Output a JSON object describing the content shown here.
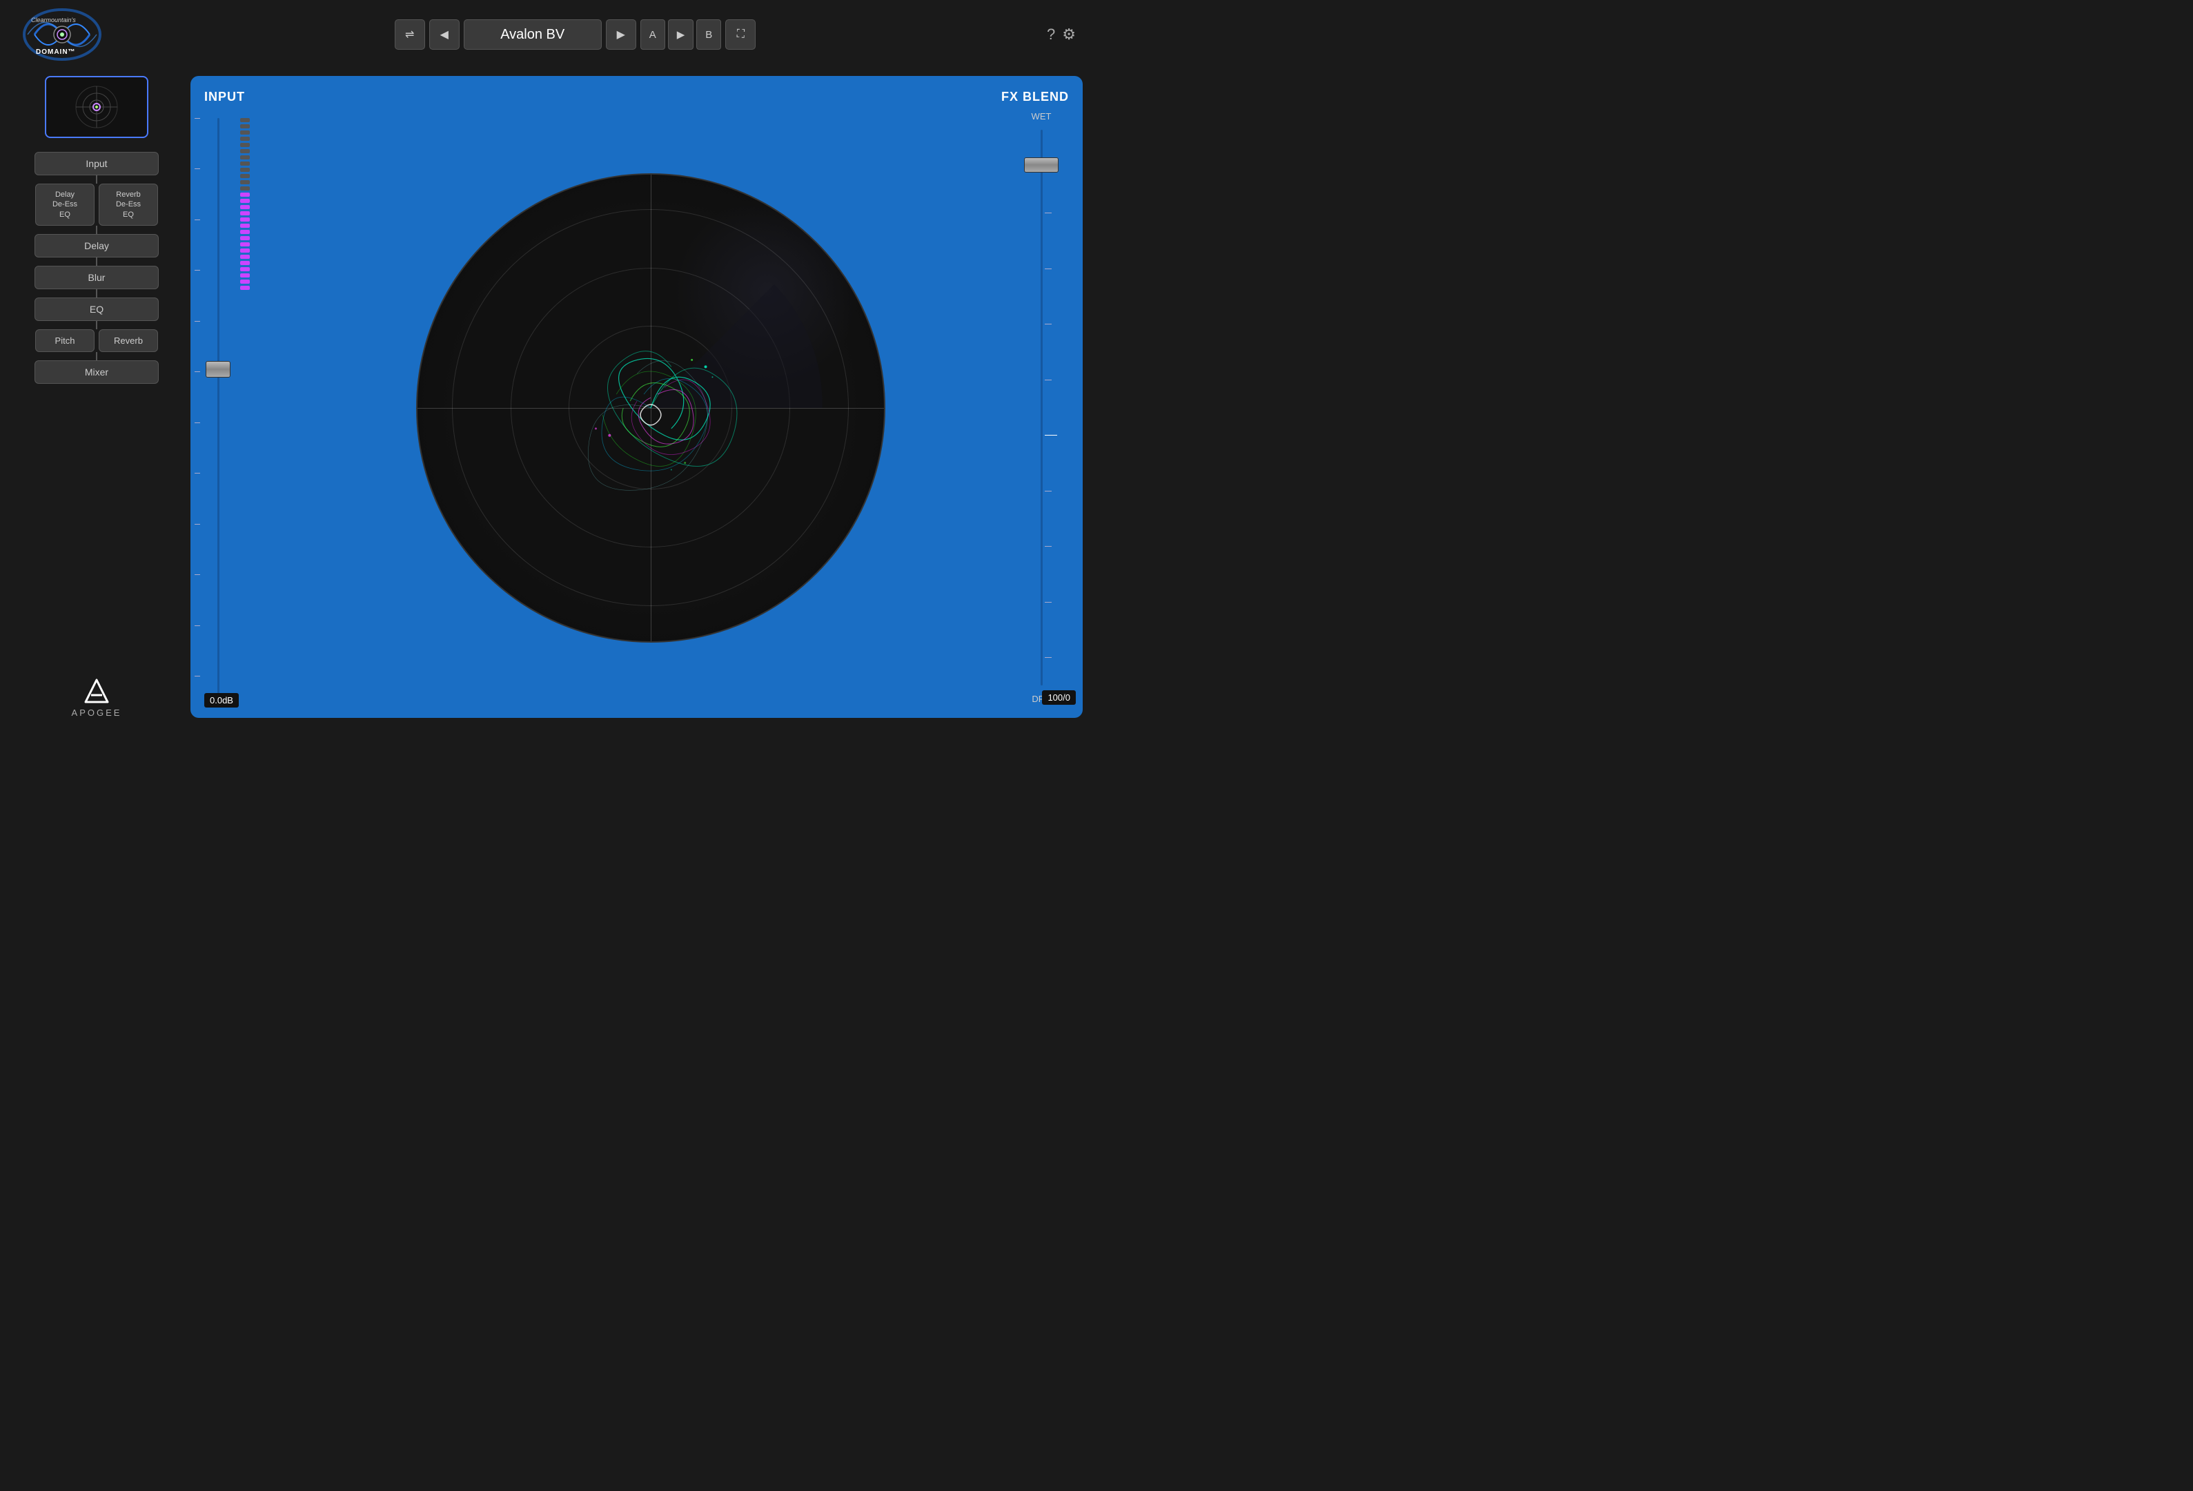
{
  "app": {
    "title": "Clearmountain's DOMAIN",
    "logo_text": "Clearmountain's\nDOMAIN"
  },
  "topbar": {
    "shuffle_label": "⇌",
    "prev_label": "◀",
    "preset_name": "Avalon BV",
    "next_label": "▶",
    "a_label": "A",
    "play_label": "▶",
    "b_label": "B",
    "fullscreen_label": "⛶",
    "help_label": "?",
    "settings_label": "⚙"
  },
  "sidebar": {
    "visualizer_label": "visualizer",
    "chain": [
      {
        "label": "Input",
        "type": "full"
      },
      {
        "label": "Delay De-Ess EQ",
        "type": "half"
      },
      {
        "label": "Reverb De-Ess EQ",
        "type": "half"
      },
      {
        "label": "Delay",
        "type": "full"
      },
      {
        "label": "Blur",
        "type": "full"
      },
      {
        "label": "EQ",
        "type": "full"
      },
      {
        "label": "Pitch",
        "type": "half"
      },
      {
        "label": "Reverb",
        "type": "half"
      },
      {
        "label": "Mixer",
        "type": "full"
      }
    ],
    "apogee_label": "APOGEE"
  },
  "input_panel": {
    "label": "INPUT",
    "fader_value": "0.0dB",
    "fader_position_pct": 42,
    "meter_dots": 28,
    "meter_active_count": 16
  },
  "fx_blend": {
    "label": "FX BLEND",
    "wet_label": "WET",
    "dry_label": "DRY",
    "value": "100/0",
    "fader_position_pct": 8,
    "mid_line_pct": 50
  },
  "radar": {
    "rings": [
      15,
      30,
      45
    ]
  }
}
